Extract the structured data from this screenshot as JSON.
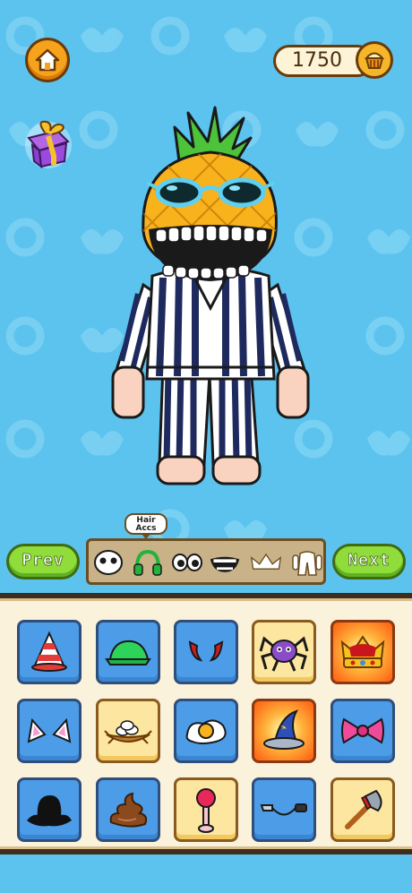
{
  "header": {
    "home_icon": "home-icon",
    "coins": "1750",
    "coin_icon": "cupcake-coin-icon",
    "gift_icon": "gift-box-icon"
  },
  "character": {
    "head": "pineapple",
    "eyes_accessory": "blue-sunglasses",
    "mouth": "wide-toothy-grin",
    "outfit": "navy-white-striped-pajamas"
  },
  "category_bar": {
    "prev_label": "Prev",
    "next_label": "Next",
    "tooltip": [
      "Hair",
      "Accs"
    ],
    "categories": [
      {
        "name": "face",
        "icon": "face-icon"
      },
      {
        "name": "hair-accs",
        "icon": "headphones-icon",
        "selected": true
      },
      {
        "name": "eyes",
        "icon": "eyes-icon"
      },
      {
        "name": "mouth",
        "icon": "mouth-icon"
      },
      {
        "name": "hat",
        "icon": "crown-icon"
      },
      {
        "name": "body",
        "icon": "body-icon"
      }
    ]
  },
  "items": [
    {
      "name": "party-hat",
      "style": "blue"
    },
    {
      "name": "green-cap",
      "style": "blue"
    },
    {
      "name": "devil-horns",
      "style": "blue"
    },
    {
      "name": "spider",
      "style": "locked"
    },
    {
      "name": "royal-crown",
      "style": "gold"
    },
    {
      "name": "cat-ears",
      "style": "blue"
    },
    {
      "name": "bird-nest",
      "style": "locked"
    },
    {
      "name": "fried-egg",
      "style": "blue"
    },
    {
      "name": "wizard-hat",
      "style": "gold"
    },
    {
      "name": "pink-bow",
      "style": "blue"
    },
    {
      "name": "black-hat",
      "style": "blue"
    },
    {
      "name": "poop",
      "style": "blue"
    },
    {
      "name": "pink-antenna",
      "style": "locked"
    },
    {
      "name": "knife-through-head",
      "style": "blue"
    },
    {
      "name": "axe",
      "style": "locked"
    }
  ],
  "colors": {
    "background": "#5cc3ee",
    "nav_button": "#8fdc3a",
    "item_blue": "#4c9ce8",
    "item_locked": "#fde7a0",
    "panel": "#fbf2dc"
  }
}
